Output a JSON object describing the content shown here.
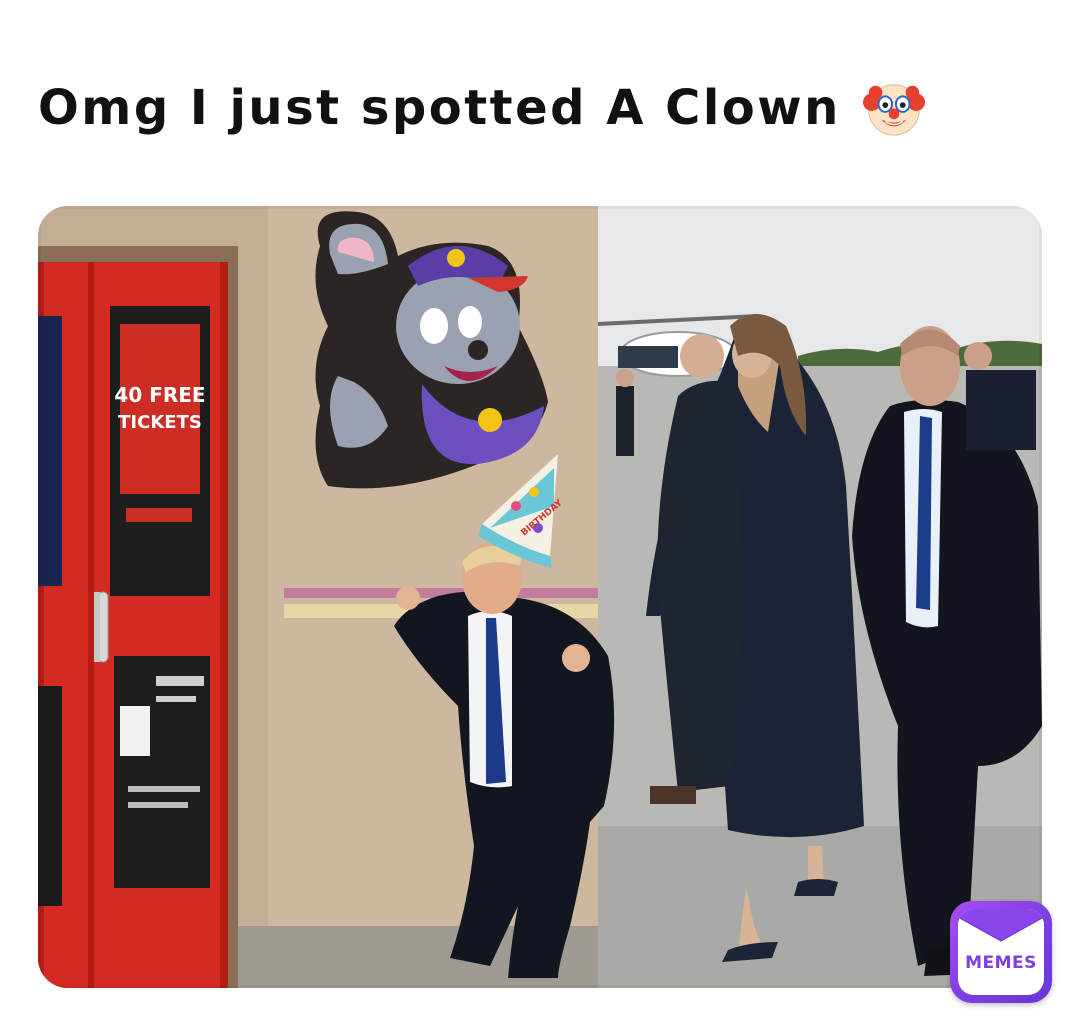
{
  "caption": {
    "text": "Omg I just spotted A Clown",
    "emoji_icon": "clown-face-icon"
  },
  "photo": {
    "sign": {
      "line1": "40 FREE",
      "line2": "TICKETS"
    },
    "hat_text": "BIRTHDAY"
  },
  "watermark": {
    "label": "MEMES",
    "icon": "envelope-icon",
    "colors": {
      "primary": "#7b3fe4",
      "secondary": "#a94cf0"
    }
  }
}
